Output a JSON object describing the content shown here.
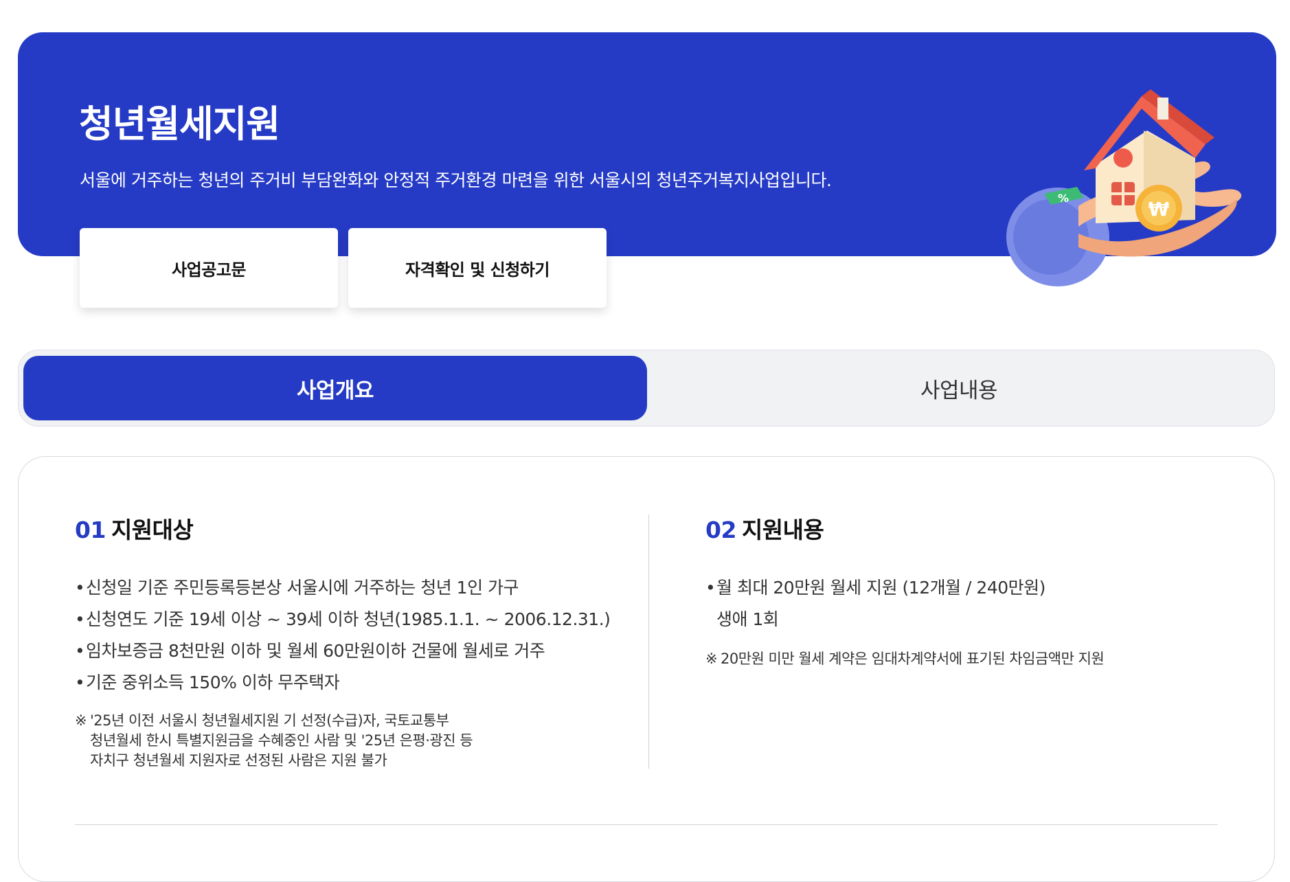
{
  "hero": {
    "title": "청년월세지원",
    "description": "서울에 거주하는 청년의 주거비 부담완화와 안정적 주거환경 마련을 위한 서울시의 청년주거복지사업입니다.",
    "buttons": [
      "사업공고문",
      "자격확인 및 신청하기"
    ],
    "illustration_labels": {
      "tag": "%",
      "coin": "₩"
    }
  },
  "tabs": [
    {
      "label": "사업개요",
      "active": true
    },
    {
      "label": "사업내용",
      "active": false
    }
  ],
  "sections": [
    {
      "number": "01",
      "title": "지원대상",
      "bullets": [
        "신청일 기준 주민등록등본상 서울시에 거주하는 청년 1인 가구",
        "신청연도 기준 19세 이상 ~ 39세 이하 청년(1985.1.1. ~ 2006.12.31.)",
        "임차보증금 8천만원 이하 및 월세 60만원이하 건물에 월세로 거주",
        "기준 중위소득 150% 이하 무주택자"
      ],
      "note_mark": "※",
      "note_lines": [
        "'25년 이전 서울시 청년월세지원 기 선정(수급)자, 국토교통부",
        "청년월세 한시 특별지원금을 수혜중인 사람 및 '25년 은평·광진 등",
        "자치구 청년월세 지원자로 선정된 사람은 지원 불가"
      ]
    },
    {
      "number": "02",
      "title": "지원내용",
      "bullet_main": "월 최대 20만원 월세 지원 (12개월 / 240만원)",
      "bullet_sub": "생애 1회",
      "note_mark": "※",
      "note": "20만원 미만 월세 계약은 임대차계약서에 표기된 차임금액만 지원"
    }
  ],
  "colors": {
    "primary": "#263bc5",
    "tab_bg": "#f1f2f4",
    "text": "#222222"
  }
}
